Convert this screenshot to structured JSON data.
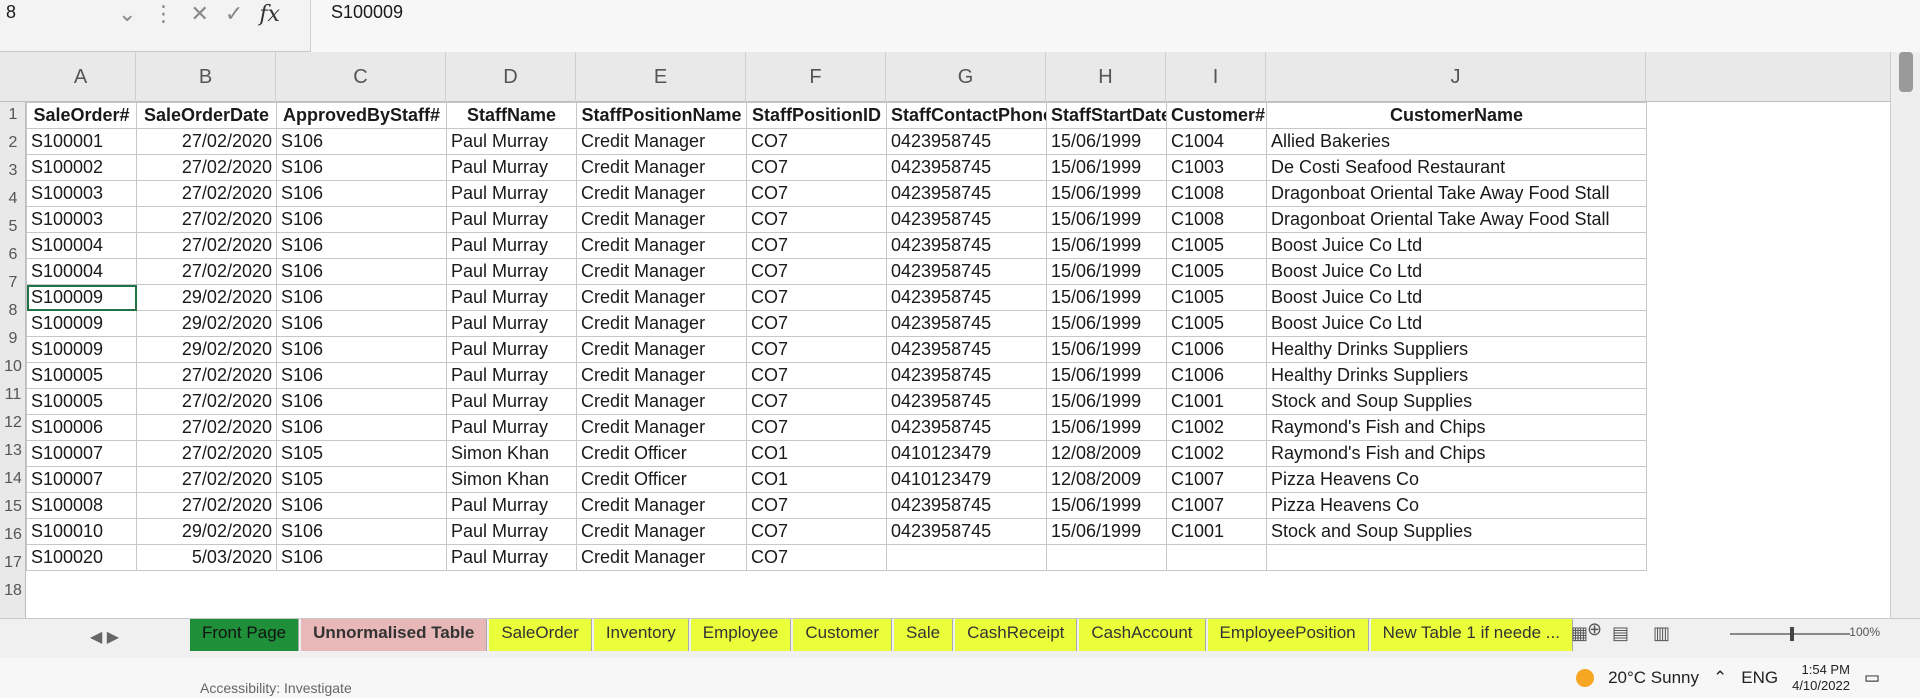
{
  "formula_bar": {
    "name_box": "8",
    "formula": "S100009",
    "icons": [
      "dropdown-icon",
      "more-icon",
      "cancel-icon",
      "confirm-icon",
      "function-icon"
    ]
  },
  "columns": [
    "A",
    "B",
    "C",
    "D",
    "E",
    "F",
    "G",
    "H",
    "I",
    "J"
  ],
  "headers": [
    "SaleOrder#",
    "SaleOrderDate",
    "ApprovedByStaff#",
    "StaffName",
    "StaffPositionName",
    "StaffPositionID",
    "StaffContactPhone",
    "StaffStartDate",
    "Customer#",
    "CustomerName"
  ],
  "row_numbers": [
    "1",
    "2",
    "3",
    "4",
    "5",
    "6",
    "7",
    "8",
    "9",
    "10",
    "11",
    "12",
    "13",
    "14",
    "15",
    "16",
    "17",
    "18"
  ],
  "rows": [
    [
      "S100001",
      "27/02/2020",
      "S106",
      "Paul Murray",
      "Credit Manager",
      "CO7",
      "0423958745",
      "15/06/1999",
      "C1004",
      "Allied Bakeries"
    ],
    [
      "S100002",
      "27/02/2020",
      "S106",
      "Paul Murray",
      "Credit Manager",
      "CO7",
      "0423958745",
      "15/06/1999",
      "C1003",
      "De Costi Seafood Restaurant"
    ],
    [
      "S100003",
      "27/02/2020",
      "S106",
      "Paul Murray",
      "Credit Manager",
      "CO7",
      "0423958745",
      "15/06/1999",
      "C1008",
      "Dragonboat Oriental Take Away Food Stall"
    ],
    [
      "S100003",
      "27/02/2020",
      "S106",
      "Paul Murray",
      "Credit Manager",
      "CO7",
      "0423958745",
      "15/06/1999",
      "C1008",
      "Dragonboat Oriental Take Away Food Stall"
    ],
    [
      "S100004",
      "27/02/2020",
      "S106",
      "Paul Murray",
      "Credit Manager",
      "CO7",
      "0423958745",
      "15/06/1999",
      "C1005",
      "Boost Juice Co Ltd"
    ],
    [
      "S100004",
      "27/02/2020",
      "S106",
      "Paul Murray",
      "Credit Manager",
      "CO7",
      "0423958745",
      "15/06/1999",
      "C1005",
      "Boost Juice Co Ltd"
    ],
    [
      "S100009",
      "29/02/2020",
      "S106",
      "Paul Murray",
      "Credit Manager",
      "CO7",
      "0423958745",
      "15/06/1999",
      "C1005",
      "Boost Juice Co Ltd"
    ],
    [
      "S100009",
      "29/02/2020",
      "S106",
      "Paul Murray",
      "Credit Manager",
      "CO7",
      "0423958745",
      "15/06/1999",
      "C1005",
      "Boost Juice Co Ltd"
    ],
    [
      "S100009",
      "29/02/2020",
      "S106",
      "Paul Murray",
      "Credit Manager",
      "CO7",
      "0423958745",
      "15/06/1999",
      "C1006",
      "Healthy Drinks Suppliers"
    ],
    [
      "S100005",
      "27/02/2020",
      "S106",
      "Paul Murray",
      "Credit Manager",
      "CO7",
      "0423958745",
      "15/06/1999",
      "C1006",
      "Healthy Drinks Suppliers"
    ],
    [
      "S100005",
      "27/02/2020",
      "S106",
      "Paul Murray",
      "Credit Manager",
      "CO7",
      "0423958745",
      "15/06/1999",
      "C1001",
      "Stock and Soup Supplies"
    ],
    [
      "S100006",
      "27/02/2020",
      "S106",
      "Paul Murray",
      "Credit Manager",
      "CO7",
      "0423958745",
      "15/06/1999",
      "C1002",
      "Raymond's Fish and Chips"
    ],
    [
      "S100007",
      "27/02/2020",
      "S105",
      "Simon Khan",
      "Credit Officer",
      "CO1",
      "0410123479",
      "12/08/2009",
      "C1002",
      "Raymond's Fish and Chips"
    ],
    [
      "S100007",
      "27/02/2020",
      "S105",
      "Simon Khan",
      "Credit Officer",
      "CO1",
      "0410123479",
      "12/08/2009",
      "C1007",
      "Pizza Heavens Co"
    ],
    [
      "S100008",
      "27/02/2020",
      "S106",
      "Paul Murray",
      "Credit Manager",
      "CO7",
      "0423958745",
      "15/06/1999",
      "C1007",
      "Pizza Heavens Co"
    ],
    [
      "S100010",
      "29/02/2020",
      "S106",
      "Paul Murray",
      "Credit Manager",
      "CO7",
      "0423958745",
      "15/06/1999",
      "C1001",
      "Stock and Soup Supplies"
    ],
    [
      "S100020",
      "5/03/2020",
      "S106",
      "Paul Murray",
      "Credit Manager",
      "CO7",
      "",
      "",
      "",
      ""
    ]
  ],
  "sheet_tabs": [
    {
      "label": "Front Page",
      "style": "green"
    },
    {
      "label": "Unnormalised Table",
      "style": "pink"
    },
    {
      "label": "SaleOrder",
      "style": "yellow"
    },
    {
      "label": "Inventory",
      "style": "yellow"
    },
    {
      "label": "Employee",
      "style": "yellow"
    },
    {
      "label": "Customer",
      "style": "yellow"
    },
    {
      "label": "Sale",
      "style": "yellow"
    },
    {
      "label": "CashReceipt",
      "style": "yellow"
    },
    {
      "label": "CashAccount",
      "style": "yellow"
    },
    {
      "label": "EmployeePosition",
      "style": "yellow"
    },
    {
      "label": "New Table 1 if neede ...",
      "style": "yellow"
    }
  ],
  "zoom": "100%",
  "status": {
    "accessibility": "Accessibility: Investigate"
  },
  "taskbar": {
    "weather": "20°C  Sunny",
    "language": "ENG",
    "time": "1:54 PM",
    "date": "4/10/2022"
  },
  "colors": {
    "tab_green": "#1f8f3a",
    "tab_pink": "#e8b8b8",
    "tab_yellow": "#eaff3a",
    "selection": "#217346"
  }
}
